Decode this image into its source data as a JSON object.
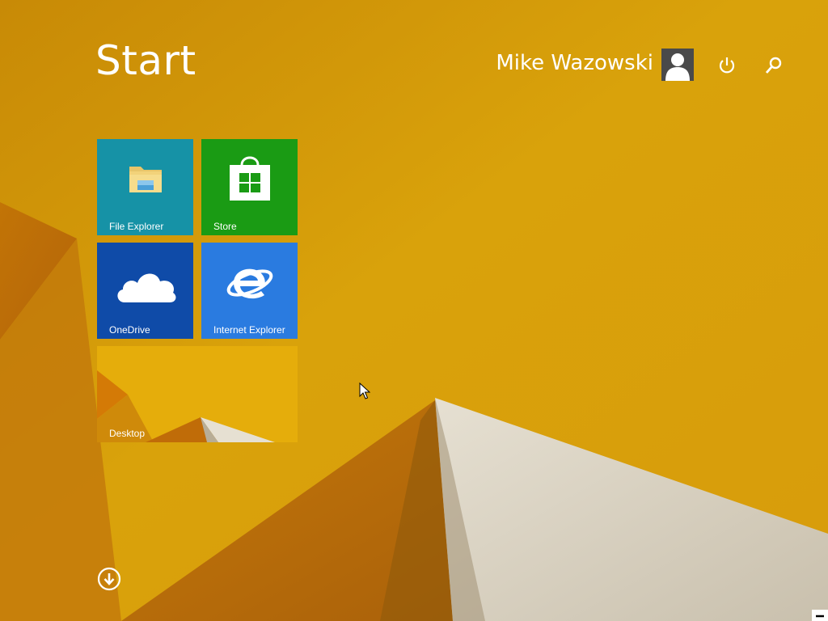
{
  "header": {
    "title": "Start",
    "user_name": "Mike Wazowski",
    "avatar_icon": "user-avatar-icon",
    "power_icon": "power-icon",
    "search_icon": "search-icon"
  },
  "tiles": [
    {
      "label": "File Explorer",
      "icon": "folder-icon",
      "color": "#1692a6"
    },
    {
      "label": "Store",
      "icon": "store-bag-icon",
      "color": "#1a9b14"
    },
    {
      "label": "OneDrive",
      "icon": "cloud-icon",
      "color": "#0f4ba8"
    },
    {
      "label": "Internet Explorer",
      "icon": "ie-icon",
      "color": "#2a7be0"
    },
    {
      "label": "Desktop",
      "icon": "desktop-wallpaper",
      "color": "#e0a707"
    }
  ],
  "footer": {
    "all_apps_icon": "arrow-down-circle-icon"
  },
  "colors": {
    "background": "#d39a0a",
    "accent_light": "#e8b21a",
    "shadow": "#b96a06"
  }
}
